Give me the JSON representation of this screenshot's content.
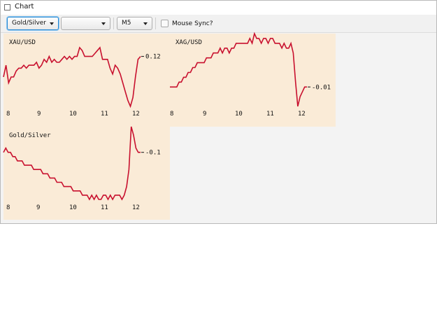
{
  "window": {
    "title": "Chart"
  },
  "toolbar": {
    "symbol_combo": "Gold/Silver",
    "second_combo": "",
    "timeframe_combo": "M5",
    "mouse_sync_label": "Mouse Sync?",
    "mouse_sync_checked": false
  },
  "colors": {
    "panel_bg": "#faebd7",
    "line": "#c8102e"
  },
  "charts": [
    {
      "name": "XAU/USD",
      "last_value": "0.12",
      "xticks": [
        "8",
        "9",
        "10",
        "11",
        "12"
      ],
      "y": [
        0.05,
        0.09,
        0.03,
        0.05,
        0.05,
        0.07,
        0.08,
        0.08,
        0.09,
        0.08,
        0.09,
        0.09,
        0.09,
        0.1,
        0.08,
        0.09,
        0.11,
        0.1,
        0.12,
        0.1,
        0.11,
        0.1,
        0.1,
        0.11,
        0.12,
        0.11,
        0.12,
        0.11,
        0.12,
        0.12,
        0.15,
        0.14,
        0.12,
        0.12,
        0.12,
        0.12,
        0.13,
        0.14,
        0.15,
        0.11,
        0.11,
        0.11,
        0.08,
        0.06,
        0.09,
        0.08,
        0.06,
        0.03,
        0.0,
        -0.03,
        -0.05,
        -0.02,
        0.05,
        0.11,
        0.12
      ]
    },
    {
      "name": "XAG/USD",
      "last_value": "-0.01",
      "xticks": [
        "8",
        "9",
        "10",
        "11",
        "12"
      ],
      "y": [
        -0.01,
        -0.01,
        -0.01,
        -0.01,
        0.0,
        0.0,
        0.01,
        0.01,
        0.02,
        0.02,
        0.03,
        0.03,
        0.04,
        0.04,
        0.04,
        0.04,
        0.05,
        0.05,
        0.05,
        0.06,
        0.06,
        0.06,
        0.07,
        0.06,
        0.07,
        0.07,
        0.06,
        0.07,
        0.07,
        0.08,
        0.08,
        0.08,
        0.08,
        0.08,
        0.08,
        0.09,
        0.08,
        0.1,
        0.09,
        0.09,
        0.08,
        0.09,
        0.09,
        0.08,
        0.09,
        0.09,
        0.08,
        0.08,
        0.08,
        0.07,
        0.08,
        0.07,
        0.07,
        0.08,
        0.06,
        0.0,
        -0.05,
        -0.03,
        -0.02,
        -0.01,
        -0.01
      ]
    },
    {
      "name": "Gold/Silver",
      "last_value": "-0.1",
      "xticks": [
        "8",
        "9",
        "10",
        "11",
        "12"
      ],
      "y": [
        -0.02,
        -0.01,
        -0.02,
        -0.02,
        -0.03,
        -0.03,
        -0.04,
        -0.04,
        -0.04,
        -0.05,
        -0.05,
        -0.05,
        -0.05,
        -0.06,
        -0.06,
        -0.06,
        -0.06,
        -0.07,
        -0.07,
        -0.07,
        -0.08,
        -0.08,
        -0.08,
        -0.09,
        -0.09,
        -0.09,
        -0.1,
        -0.1,
        -0.1,
        -0.1,
        -0.11,
        -0.11,
        -0.11,
        -0.11,
        -0.12,
        -0.12,
        -0.12,
        -0.13,
        -0.12,
        -0.13,
        -0.12,
        -0.13,
        -0.13,
        -0.12,
        -0.12,
        -0.13,
        -0.12,
        -0.13,
        -0.12,
        -0.12,
        -0.12,
        -0.13,
        -0.12,
        -0.1,
        -0.06,
        0.04,
        0.02,
        -0.01,
        -0.02,
        -0.02
      ]
    }
  ]
}
